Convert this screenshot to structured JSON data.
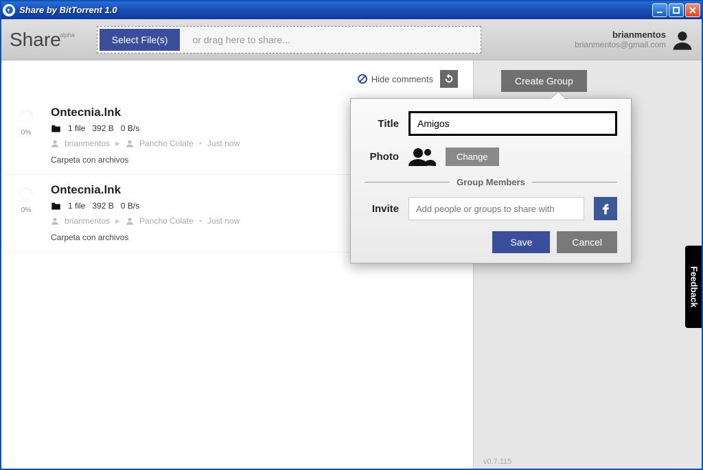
{
  "window": {
    "title": "Share by BitTorrent 1.0"
  },
  "header": {
    "share_label": "Share",
    "share_tag": "alpha",
    "select_files": "Select File(s)",
    "drag_hint": "or drag here to share...",
    "user_name": "brianmentos",
    "user_email": "brianmentos@gmail.com"
  },
  "toolbar": {
    "hide_comments": "Hide comments"
  },
  "items": [
    {
      "title": "Ontecnia.lnk",
      "progress": "0%",
      "files": "1 file",
      "size": "392 B",
      "speed": "0 B/s",
      "from": "brianmentos",
      "to": "Pancho Colate",
      "when": "Just now",
      "desc": "Carpeta con archivos"
    },
    {
      "title": "Ontecnia.lnk",
      "progress": "0%",
      "files": "1 file",
      "size": "392 B",
      "speed": "0 B/s",
      "from": "brianmentos",
      "to": "Pancho Colate",
      "when": "Just now",
      "desc": "Carpeta con archivos"
    }
  ],
  "create_group": {
    "button": "Create Group",
    "title_label": "Title",
    "title_value": "Amigos",
    "photo_label": "Photo",
    "change": "Change",
    "members_label": "Group Members",
    "invite_label": "Invite",
    "invite_placeholder": "Add people or groups to share with",
    "save": "Save",
    "cancel": "Cancel"
  },
  "footer": {
    "version": "v0.7.115",
    "feedback": "Feedback"
  }
}
